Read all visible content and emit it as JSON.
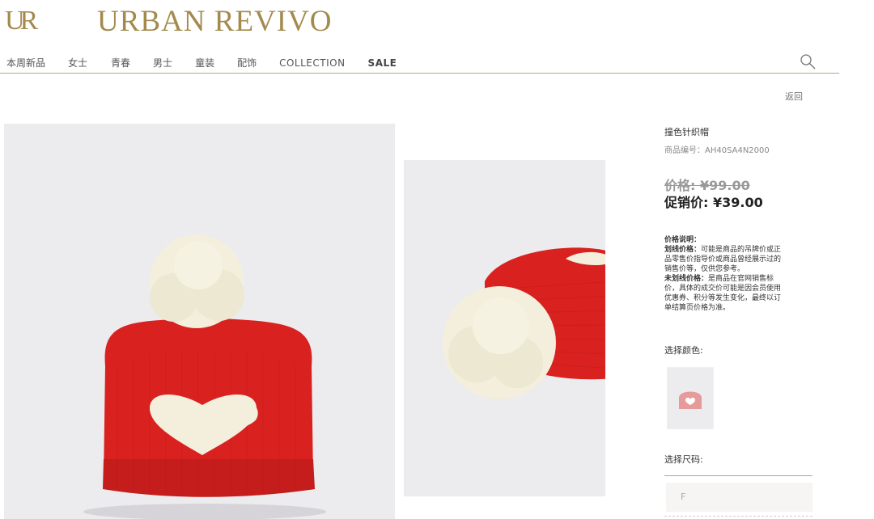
{
  "brand": {
    "mark": "UR",
    "name": "URBAN REVIVO"
  },
  "nav": [
    {
      "label": "本周新品"
    },
    {
      "label": "女士"
    },
    {
      "label": "青春"
    },
    {
      "label": "男士"
    },
    {
      "label": "童装"
    },
    {
      "label": "配饰"
    },
    {
      "label": "COLLECTION"
    },
    {
      "label": "SALE"
    }
  ],
  "back_label": "返回",
  "product": {
    "name": "撞色针织帽",
    "code": "商品编号：AH40SA4N2000",
    "price_original": "价格: ¥99.00",
    "price_sale": "促销价: ¥39.00",
    "note_title": "价格说明：",
    "note_strike_label": "划线价格：",
    "note_strike_text": "可能是商品的吊牌价或正品零售价指导价或商品曾经展示过的销售价等，仅供您参考。",
    "note_nostrike_label": "未划线价格：",
    "note_nostrike_text": "是商品在官网销售标价，具体的成交价可能是因会员使用优惠券、积分等发生变化，最终以订单结算页价格为准。",
    "color_label": "选择颜色:",
    "size_label": "选择尺码:",
    "size_value": "F"
  },
  "colors": {
    "accent": "#a38a4c",
    "hat_red": "#d9211f",
    "pompom": "#f3efdc"
  },
  "icons": {
    "search": "search-icon"
  }
}
